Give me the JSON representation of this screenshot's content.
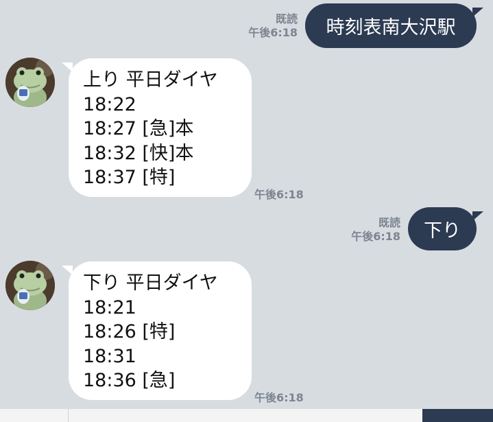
{
  "messages": [
    {
      "direction": "out",
      "text": "時刻表南大沢駅",
      "read_label": "既読",
      "time": "午後6:18"
    },
    {
      "direction": "in",
      "lines": [
        "上り 平日ダイヤ",
        "18:22",
        "18:27 [急]本",
        "18:32 [快]本",
        "18:37 [特]"
      ],
      "time": "午後6:18"
    },
    {
      "direction": "out",
      "text": "下り",
      "read_label": "既読",
      "time": "午後6:18"
    },
    {
      "direction": "in",
      "lines": [
        "下り 平日ダイヤ",
        "18:21",
        "18:26 [特]",
        "18:31",
        "18:36 [急]"
      ],
      "time": "午後6:18"
    }
  ],
  "avatar_icon": "frog-figure-avatar-icon",
  "colors": {
    "chat_background": "#d7dce1",
    "outgoing_bubble": "#2c3a52",
    "incoming_bubble": "#ffffff",
    "meta_text": "#7c8590"
  }
}
